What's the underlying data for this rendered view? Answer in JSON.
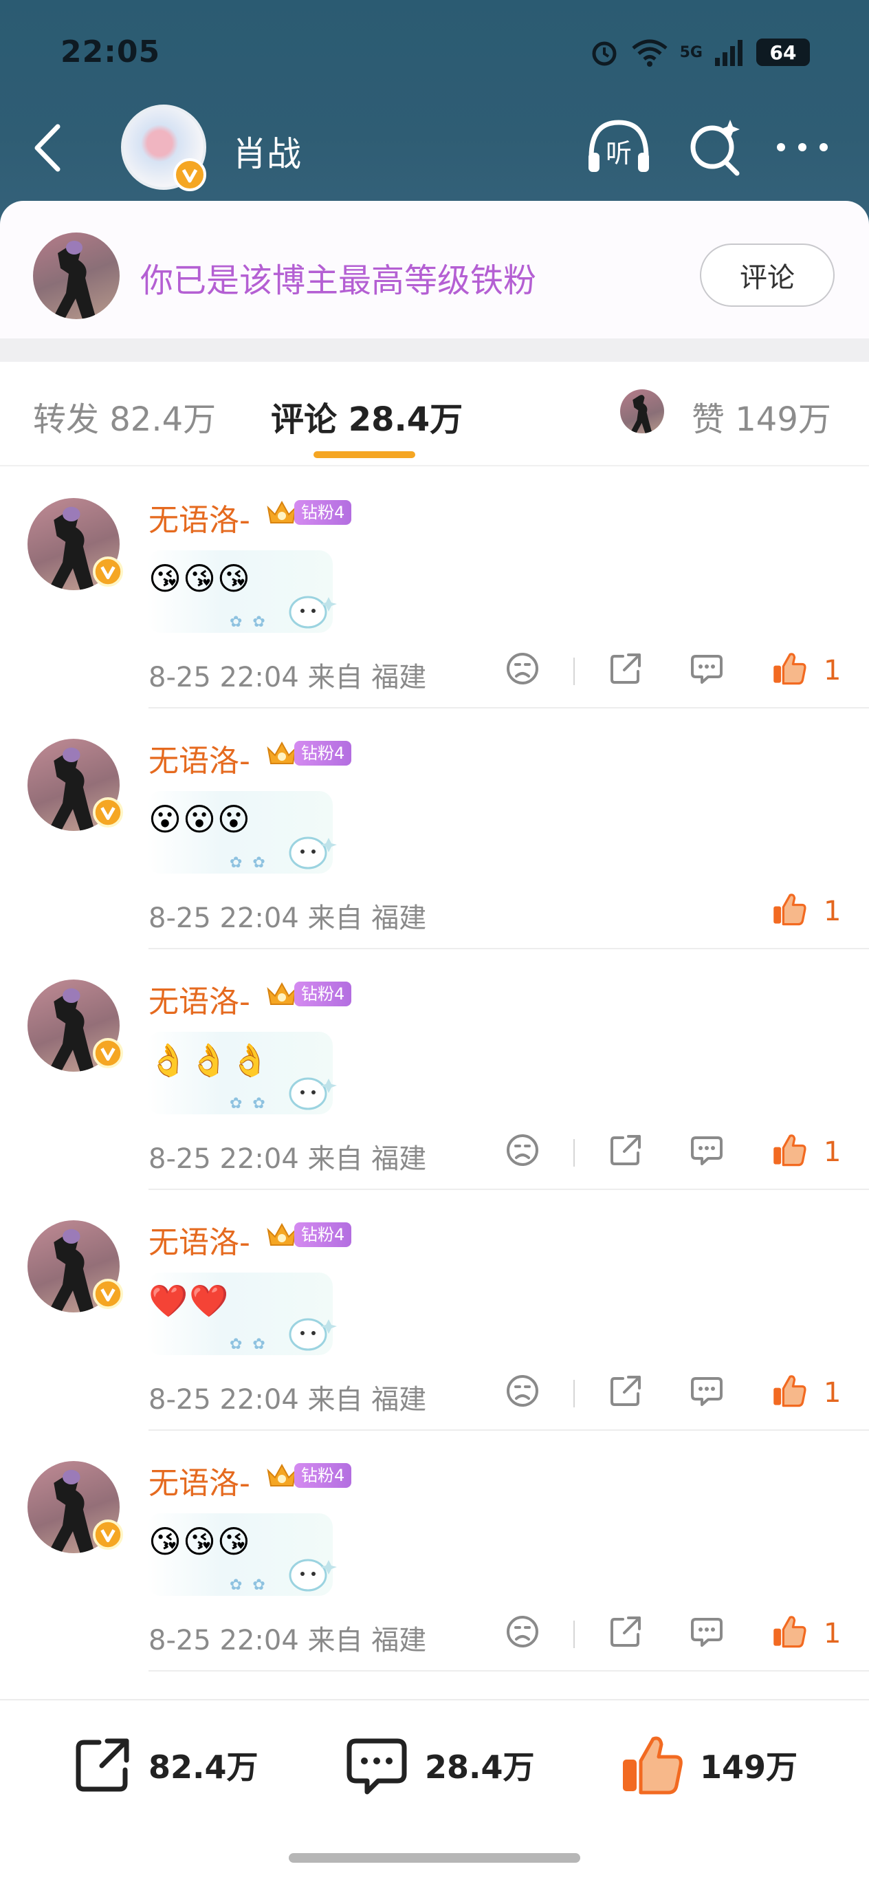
{
  "status_bar": {
    "time": "22:05",
    "network": "5G",
    "battery": "64"
  },
  "header": {
    "author_name": "肖战",
    "listen_label": "听"
  },
  "fan_banner": {
    "message": "你已是该博主最高等级铁粉",
    "button_label": "评论"
  },
  "tabs": {
    "repost": "转发 82.4万",
    "comment": "评论 28.4万",
    "like": "赞 149万"
  },
  "comments": [
    {
      "username": "无语洛-",
      "badge": "钻粉4",
      "emoji": "😘😘😘",
      "meta": "8-25 22:04 来自 福建",
      "likes": "1",
      "has_extra_actions": true
    },
    {
      "username": "无语洛-",
      "badge": "钻粉4",
      "emoji": "😮😮😮",
      "meta": "8-25 22:04 来自 福建",
      "likes": "1",
      "has_extra_actions": false
    },
    {
      "username": "无语洛-",
      "badge": "钻粉4",
      "emoji": "👌👌👌",
      "meta": "8-25 22:04 来自 福建",
      "likes": "1",
      "has_extra_actions": true
    },
    {
      "username": "无语洛-",
      "badge": "钻粉4",
      "emoji": "❤️❤️",
      "meta": "8-25 22:04 来自 福建",
      "likes": "1",
      "has_extra_actions": true
    },
    {
      "username": "无语洛-",
      "badge": "钻粉4",
      "emoji": "😘😘😘",
      "meta": "8-25 22:04 来自 福建",
      "likes": "1",
      "has_extra_actions": true
    }
  ],
  "bottom_bar": {
    "repost_count": "82.4万",
    "comment_count": "28.4万",
    "like_count": "149万"
  },
  "colors": {
    "header_bg": "#2f5d74",
    "accent_orange": "#f5a623",
    "username_orange": "#e56a1f",
    "fan_purple": "#b45fd3",
    "like_orange": "#e4661e"
  }
}
